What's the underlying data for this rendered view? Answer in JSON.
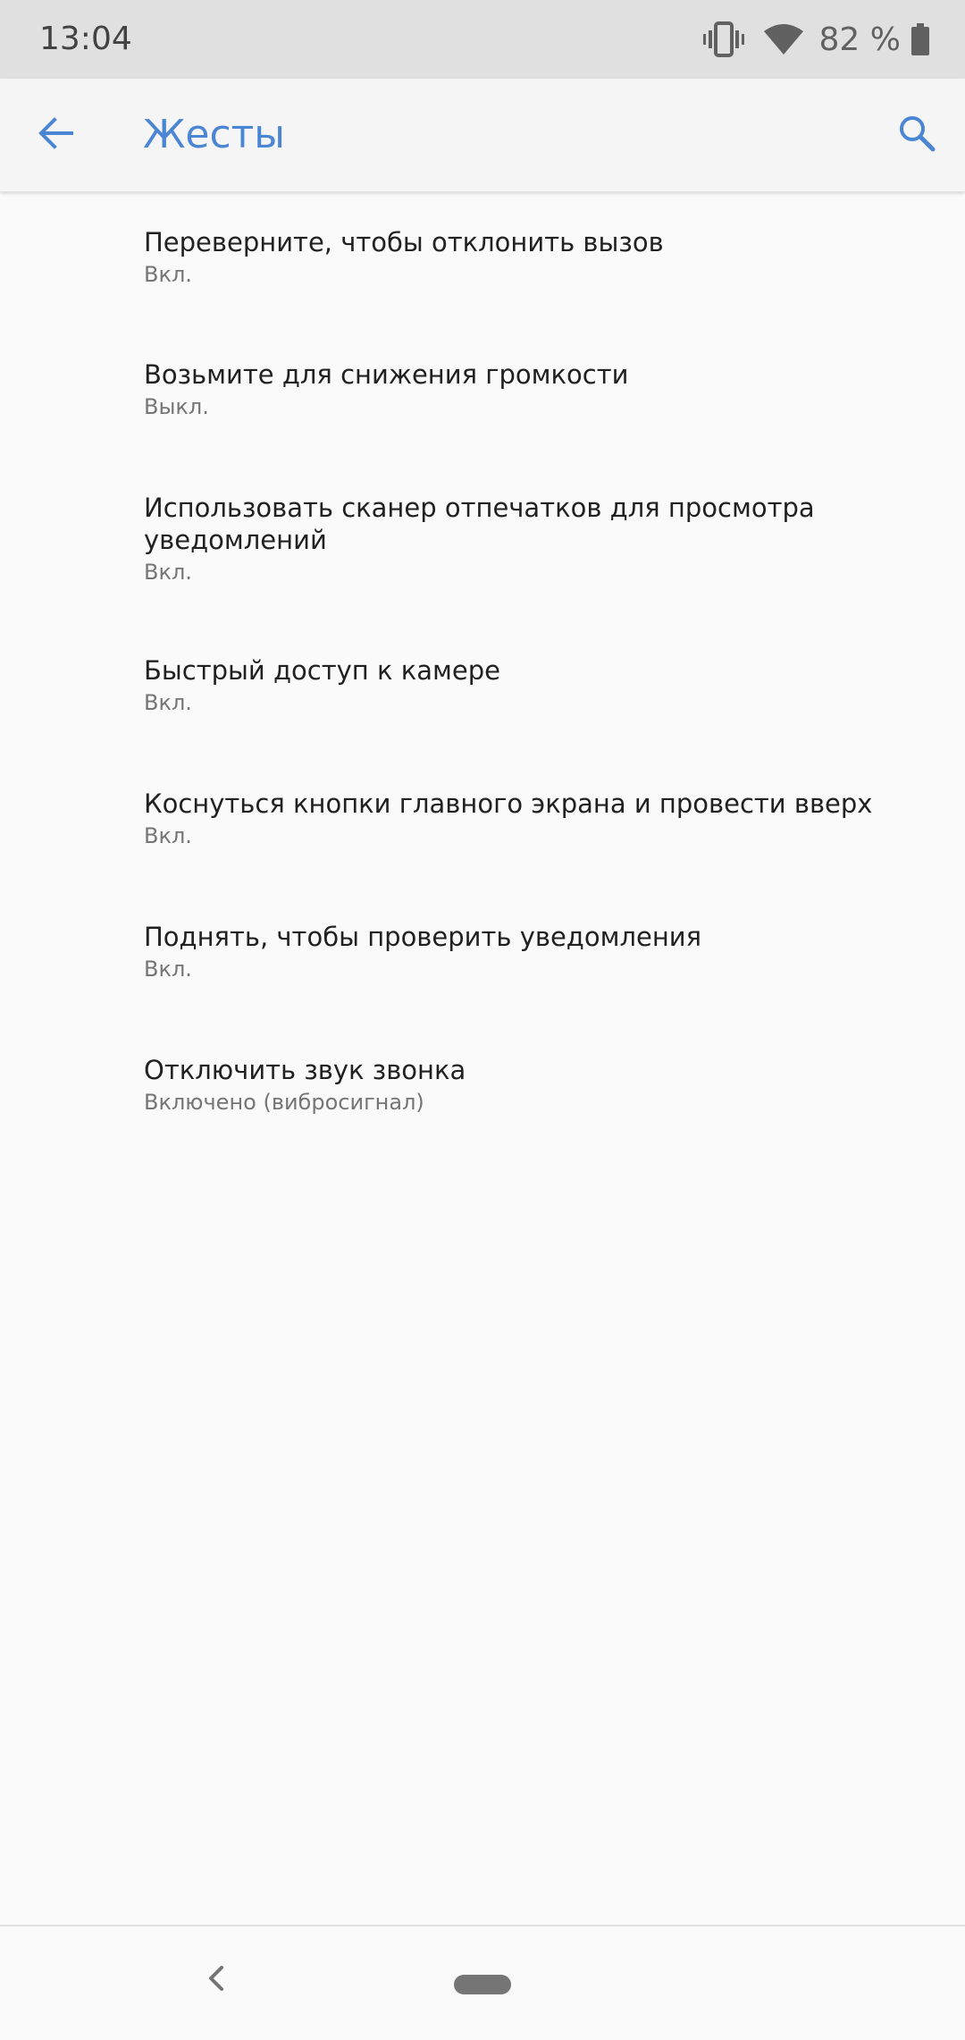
{
  "status_bar": {
    "time": "13:04",
    "battery_text": "82 %",
    "icons": [
      "vibrate-icon",
      "wifi-icon",
      "battery-icon"
    ]
  },
  "app_bar": {
    "title": "Жесты",
    "back_icon": "arrow-back-icon",
    "search_icon": "search-icon",
    "accent_color": "#4a86d4"
  },
  "gestures": [
    {
      "title": "Переверните, чтобы отклонить вызов",
      "summary": "Вкл."
    },
    {
      "title": "Возьмите для снижения громкости",
      "summary": "Выкл."
    },
    {
      "title": "Использовать сканер отпечатков для просмотра уведомлений",
      "summary": "Вкл."
    },
    {
      "title": "Быстрый доступ к камере",
      "summary": "Вкл."
    },
    {
      "title": "Коснуться кнопки главного экрана и провести вверх",
      "summary": "Вкл."
    },
    {
      "title": "Поднять, чтобы проверить уведомления",
      "summary": "Вкл."
    },
    {
      "title": "Отключить звук звонка",
      "summary": "Включено (вибросигнал)"
    }
  ],
  "nav_bar": {
    "back_icon": "chevron-left-icon",
    "home_icon": "home-pill-icon"
  }
}
